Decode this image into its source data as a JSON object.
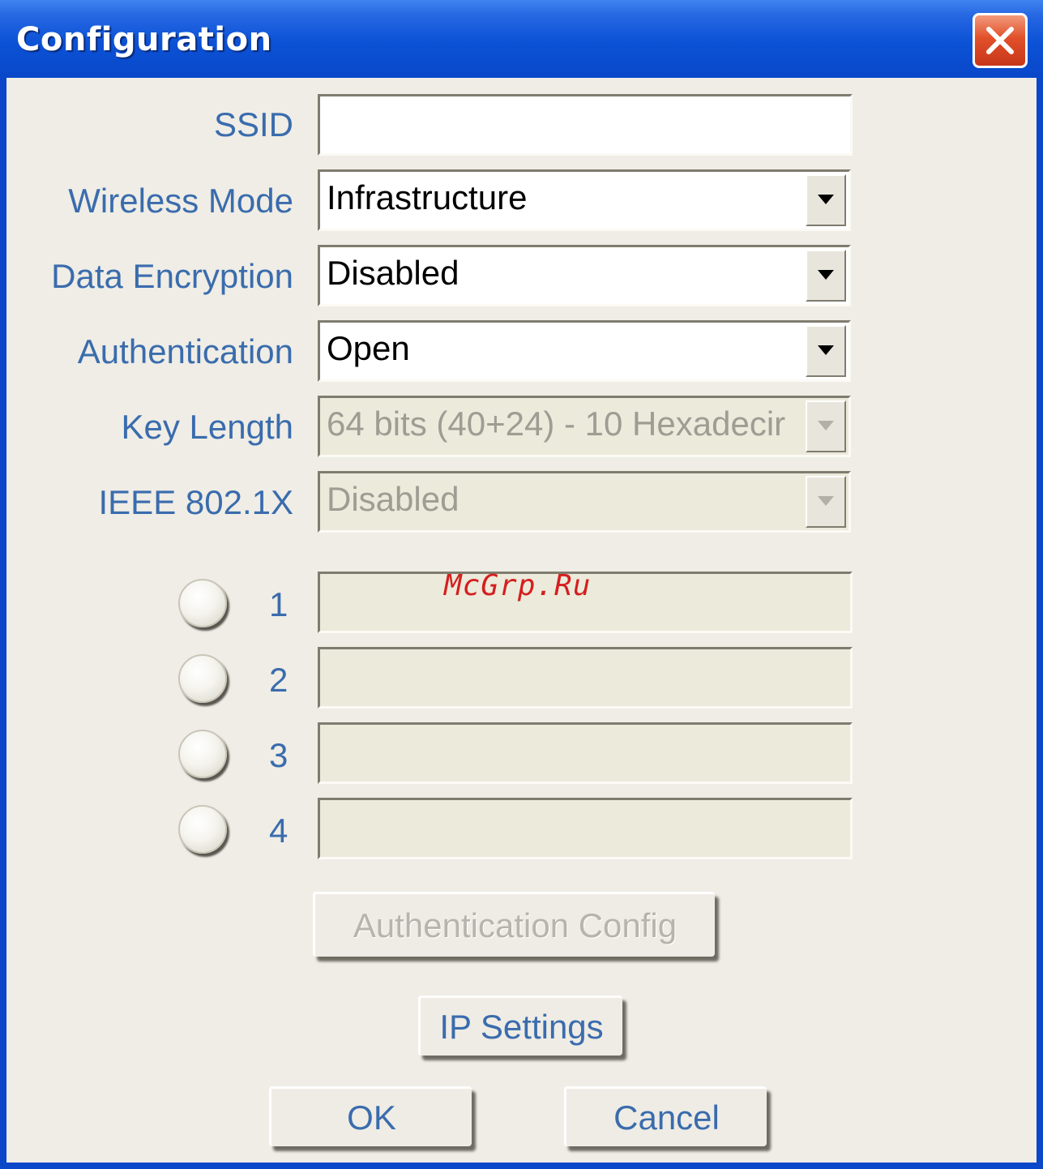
{
  "window": {
    "title": "Configuration"
  },
  "fields": {
    "ssid": {
      "label": "SSID",
      "value": ""
    },
    "wireless_mode": {
      "label": "Wireless Mode",
      "value": "Infrastructure"
    },
    "data_encryption": {
      "label": "Data Encryption",
      "value": "Disabled"
    },
    "authentication": {
      "label": "Authentication",
      "value": "Open"
    },
    "key_length": {
      "label": "Key Length",
      "value": "64 bits (40+24) - 10 Hexadecir"
    },
    "ieee_8021x": {
      "label": "IEEE 802.1X",
      "value": "Disabled"
    }
  },
  "keys": [
    {
      "number": "1",
      "value": ""
    },
    {
      "number": "2",
      "value": ""
    },
    {
      "number": "3",
      "value": ""
    },
    {
      "number": "4",
      "value": ""
    }
  ],
  "buttons": {
    "auth_config": "Authentication Config",
    "ip_settings": "IP Settings",
    "ok": "OK",
    "cancel": "Cancel"
  },
  "watermark": "McGrp.Ru",
  "icons": {
    "close": "close-icon",
    "dropdown": "chevron-down-icon",
    "radio": "radio-button"
  },
  "colors": {
    "title_bar": "#0a47c9",
    "label_text": "#3a6cad",
    "close_button": "#e1502a",
    "client_bg": "#efede6",
    "disabled_field": "#eceadb"
  }
}
